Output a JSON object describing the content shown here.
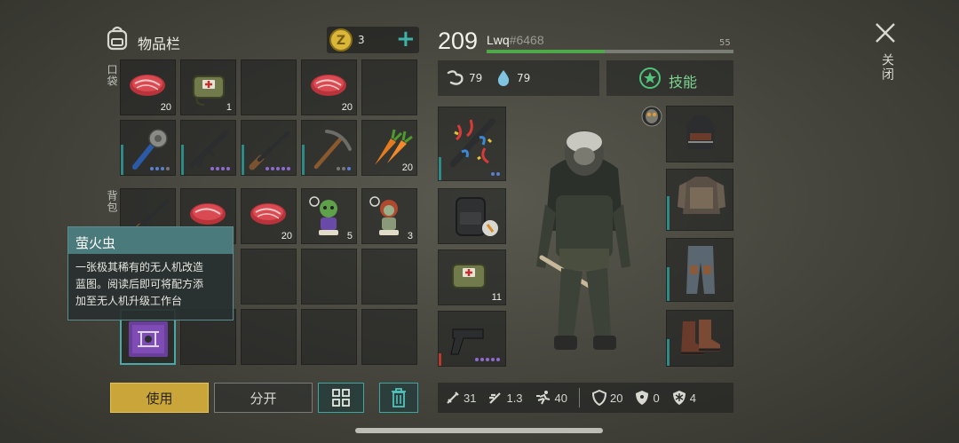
{
  "inventory": {
    "title": "物品栏",
    "coins": "3",
    "pocket_label": "口袋",
    "backpack_label": "背包",
    "pocket_row1": [
      {
        "icon": "meat-icon",
        "count": "20"
      },
      {
        "icon": "medkit-bag-icon",
        "count": "1"
      },
      {
        "icon": "",
        "count": ""
      },
      {
        "icon": "meat-icon",
        "count": "20"
      },
      {
        "icon": "",
        "count": ""
      }
    ],
    "pocket_row2": [
      {
        "icon": "spiked-club-icon",
        "count": ""
      },
      {
        "icon": "assault-rifle-icon",
        "count": ""
      },
      {
        "icon": "shotgun-icon",
        "count": ""
      },
      {
        "icon": "pickaxe-icon",
        "count": ""
      },
      {
        "icon": "carrot-icon",
        "count": "20"
      }
    ],
    "backpack_row1": [
      {
        "icon": "shotgun-icon",
        "count": ""
      },
      {
        "icon": "meat-icon",
        "count": ""
      },
      {
        "icon": "meat-icon",
        "count": "20"
      },
      {
        "icon": "zombie-figure-icon",
        "count": "5"
      },
      {
        "icon": "zombie-figure-icon",
        "count": "3"
      }
    ],
    "selected_item_icon": "drone-blueprint-icon"
  },
  "tooltip": {
    "title": "萤火虫",
    "line1": "一张极其稀有的无人机改造",
    "line2": "蓝图。阅读后即可将配方添",
    "line3": "加至无人机升级工作台"
  },
  "actions": {
    "use": "使用",
    "split": "分开",
    "sort_icon": "grid-sort-icon",
    "trash_icon": "trash-icon"
  },
  "player": {
    "level": "209",
    "name": "Lwq",
    "tag": "#6468",
    "xp_value": "55",
    "xp_fraction": 0.48,
    "hunger": "79",
    "thirst": "79",
    "skills_label": "技能"
  },
  "equipment_left": [
    {
      "icon": "firework-crossbow-icon",
      "count": ""
    },
    {
      "icon": "backpack-icon",
      "count": ""
    },
    {
      "icon": "medkit-bag-icon",
      "count": "11"
    },
    {
      "icon": "pistol-icon",
      "count": ""
    }
  ],
  "equipment_right": [
    {
      "icon": "helmet-icon"
    },
    {
      "icon": "armor-vest-icon"
    },
    {
      "icon": "armor-pants-icon"
    },
    {
      "icon": "boots-icon"
    }
  ],
  "stats": {
    "melee": "31",
    "speed_melee": "1.3",
    "run": "40",
    "armor": "20",
    "radiation": "0",
    "cold": "4"
  },
  "close_label": "关闭",
  "colors": {
    "accent_teal": "#2e8a86",
    "xp_green": "#4fa84a",
    "use_button_gold": "#c9a53a",
    "tooltip_header": "#4a7a7c"
  }
}
